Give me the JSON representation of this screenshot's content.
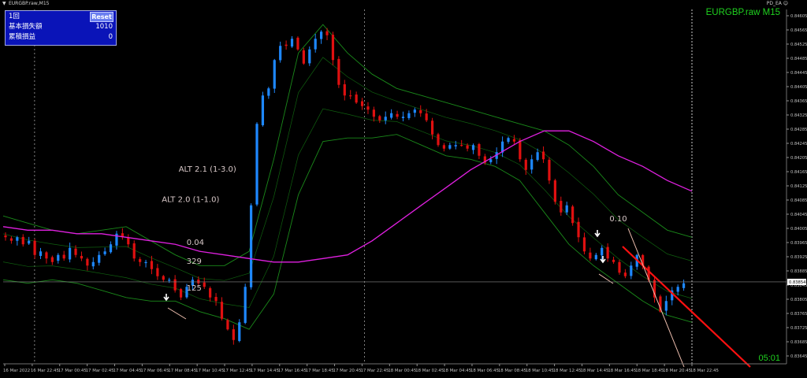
{
  "window": {
    "title": "EURGBP.raw,M15",
    "ea_label": "PD_EA ☺"
  },
  "panel": {
    "count_label": "1回",
    "reset_label": "Reset",
    "base_loss_label": "基本損失額",
    "base_loss_value": "1010",
    "cum_pl_label": "累積損益",
    "cum_pl_value": "0"
  },
  "symbol_label": "EURGBP.raw M15",
  "timer": "05:01",
  "colors": {
    "bg": "#000000",
    "bull": "#1e88ff",
    "bear": "#e01010",
    "band": "#1a8a1a",
    "ma": "#e020e0",
    "axis": "#c0c0c0",
    "text": "#d8c8c8",
    "trend": "#ff1010"
  },
  "chart_data": {
    "type": "candlestick",
    "symbol": "EURGBP.raw",
    "timeframe": "M15",
    "ylim": [
      0.83645,
      0.84605
    ],
    "y_ticks": [
      "0.84605",
      "0.84565",
      "0.84525",
      "0.84485",
      "0.84445",
      "0.84405",
      "0.84365",
      "0.84325",
      "0.84285",
      "0.84245",
      "0.84205",
      "0.84165",
      "0.84125",
      "0.84085",
      "0.84045",
      "0.84005",
      "0.83965",
      "0.83925",
      "0.83885",
      "0.83845",
      "0.83805",
      "0.83765",
      "0.83725",
      "0.83685",
      "0.83645"
    ],
    "current_price": "0.83854",
    "x_ticks": [
      "16 Mar 2022",
      "16 Mar 22:45",
      "17 Mar 00:45",
      "17 Mar 02:45",
      "17 Mar 04:45",
      "17 Mar 06:45",
      "17 Mar 08:45",
      "17 Mar 10:45",
      "17 Mar 12:45",
      "17 Mar 14:45",
      "17 Mar 16:45",
      "17 Mar 18:45",
      "17 Mar 20:45",
      "17 Mar 22:45",
      "18 Mar 00:45",
      "18 Mar 02:45",
      "18 Mar 04:45",
      "18 Mar 06:45",
      "18 Mar 08:45",
      "18 Mar 10:45",
      "18 Mar 12:45",
      "18 Mar 14:45",
      "18 Mar 16:45",
      "18 Mar 18:45",
      "18 Mar 20:45",
      "18 Mar 22:45"
    ],
    "period_separators": [
      "16 Mar 22:45",
      "17 Mar 22:45"
    ],
    "close_path": [
      0.8398,
      0.8397,
      0.8398,
      0.8396,
      0.8397,
      0.8393,
      0.8394,
      0.8392,
      0.8391,
      0.8393,
      0.8392,
      0.8395,
      0.8393,
      0.8392,
      0.839,
      0.8391,
      0.8393,
      0.8394,
      0.8396,
      0.8399,
      0.8398,
      0.8396,
      0.8392,
      0.8391,
      0.8391,
      0.8389,
      0.8387,
      0.8386,
      0.8386,
      0.8383,
      0.8381,
      0.8384,
      0.8386,
      0.8385,
      0.8384,
      0.8381,
      0.838,
      0.8375,
      0.8372,
      0.8369,
      0.8374,
      0.8384,
      0.8407,
      0.843,
      0.8438,
      0.844,
      0.8448,
      0.8452,
      0.8452,
      0.8454,
      0.8451,
      0.8447,
      0.8451,
      0.8454,
      0.8456,
      0.8455,
      0.8448,
      0.8441,
      0.8438,
      0.8438,
      0.8436,
      0.8435,
      0.8434,
      0.8432,
      0.8431,
      0.8432,
      0.8433,
      0.8432,
      0.8432,
      0.8433,
      0.8434,
      0.8433,
      0.8431,
      0.8427,
      0.8424,
      0.8423,
      0.8424,
      0.8424,
      0.8424,
      0.8423,
      0.8424,
      0.8421,
      0.8419,
      0.842,
      0.8422,
      0.8425,
      0.8426,
      0.8425,
      0.842,
      0.8417,
      0.842,
      0.8422,
      0.842,
      0.8414,
      0.8408,
      0.8405,
      0.8407,
      0.8402,
      0.8398,
      0.8394,
      0.8392,
      0.8393,
      0.8395,
      0.8392,
      0.8391,
      0.8388,
      0.8387,
      0.839,
      0.8393,
      0.839,
      0.8386,
      0.8381,
      0.8377,
      0.838,
      0.8383,
      0.8384,
      0.8385
    ],
    "series": [
      {
        "values": [
          0.8401,
          0.84,
          0.84,
          0.8399,
          0.8399,
          0.8398,
          0.8397,
          0.8396,
          0.8394,
          0.8393,
          0.8392,
          0.8391,
          0.8391,
          0.8392,
          0.8393,
          0.8397,
          0.8402,
          0.8407,
          0.8412,
          0.8417,
          0.8421,
          0.8425,
          0.8428,
          0.8428,
          0.8425,
          0.8421,
          0.8418,
          0.8414,
          0.8411
        ]
      },
      {
        "values": [
          0.8404,
          0.8402,
          0.84,
          0.8399,
          0.84,
          0.8401,
          0.8397,
          0.8393,
          0.839,
          0.839,
          0.8394,
          0.842,
          0.845,
          0.8458,
          0.845,
          0.8444,
          0.844,
          0.8438,
          0.8436,
          0.8434,
          0.8432,
          0.843,
          0.8428,
          0.8424,
          0.8418,
          0.841,
          0.8405,
          0.84,
          0.8398
        ]
      },
      {
        "values": [
          0.8386,
          0.8385,
          0.8386,
          0.8385,
          0.8383,
          0.8381,
          0.838,
          0.838,
          0.8377,
          0.8375,
          0.8372,
          0.8382,
          0.841,
          0.8425,
          0.8426,
          0.8426,
          0.8427,
          0.8424,
          0.8421,
          0.842,
          0.8418,
          0.8414,
          0.8405,
          0.8396,
          0.839,
          0.8385,
          0.838,
          0.8376,
          0.8374
        ]
      }
    ],
    "annotations": [
      {
        "text": "ALT 2.0 (1-1.0)",
        "x": "17 Mar 08:45",
        "y": 0.8408
      },
      {
        "text": "ALT 2.1 (1-3.0)",
        "x": "18 Mar 15:45",
        "y": 0.84165
      },
      {
        "text": "0.04",
        "x": "17 Mar 10:00",
        "y": 0.83958
      },
      {
        "text": "125",
        "x": "17 Mar 10:00",
        "y": 0.8383
      },
      {
        "text": "0.10",
        "x": "18 Mar 16:45",
        "y": 0.84025
      },
      {
        "text": "329",
        "x": "18 Mar 17:45",
        "y": 0.83905
      }
    ]
  }
}
